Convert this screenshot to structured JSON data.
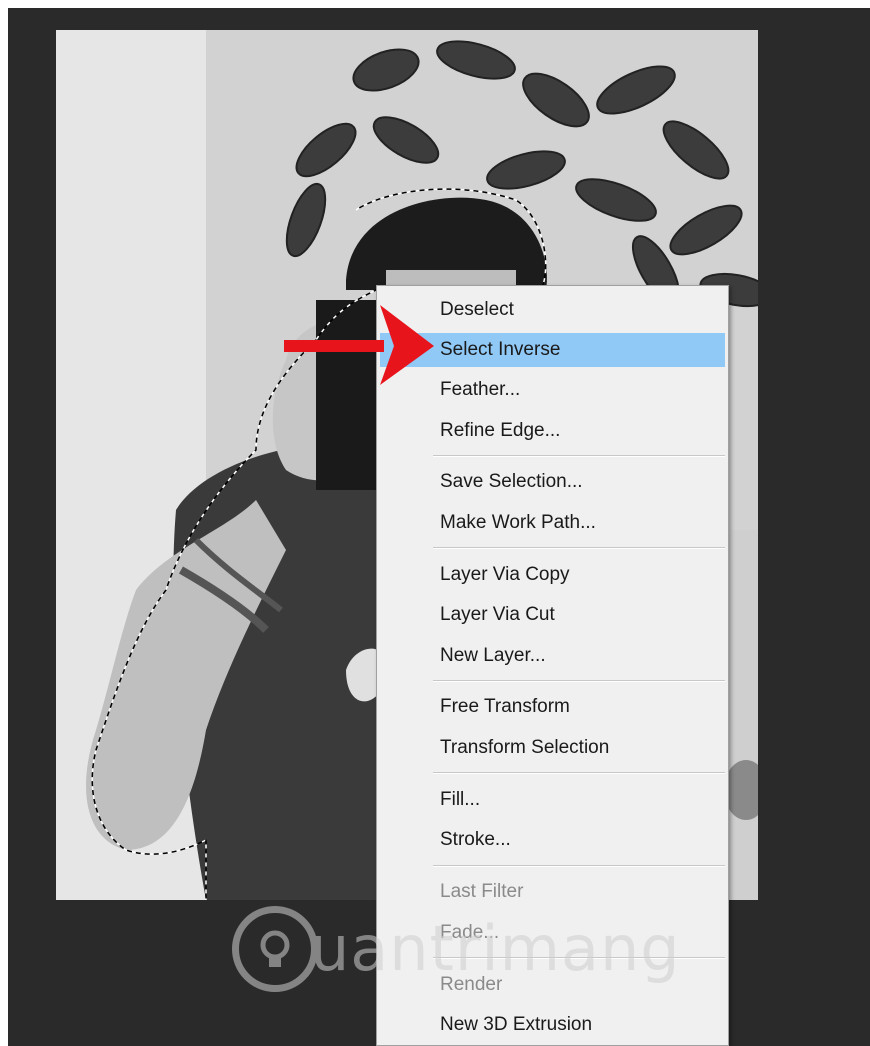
{
  "context_menu": {
    "items": [
      {
        "label": "Deselect",
        "state": "normal"
      },
      {
        "label": "Select Inverse",
        "state": "highlighted"
      },
      {
        "label": "Feather...",
        "state": "normal"
      },
      {
        "label": "Refine Edge...",
        "state": "normal"
      },
      {
        "label": "Save Selection...",
        "state": "normal"
      },
      {
        "label": "Make Work Path...",
        "state": "normal"
      },
      {
        "label": "Layer Via Copy",
        "state": "normal"
      },
      {
        "label": "Layer Via Cut",
        "state": "normal"
      },
      {
        "label": "New Layer...",
        "state": "normal"
      },
      {
        "label": "Free Transform",
        "state": "normal"
      },
      {
        "label": "Transform Selection",
        "state": "normal"
      },
      {
        "label": "Fill...",
        "state": "normal"
      },
      {
        "label": "Stroke...",
        "state": "normal"
      },
      {
        "label": "Last Filter",
        "state": "disabled"
      },
      {
        "label": "Fade...",
        "state": "disabled"
      },
      {
        "label": "Render",
        "state": "disabled"
      },
      {
        "label": "New 3D Extrusion",
        "state": "normal"
      }
    ]
  },
  "annotation": {
    "icon": "red-arrow-icon",
    "color": "#e8141c"
  },
  "watermark": {
    "text": "uantrimang",
    "icon": "lightbulb-icon"
  },
  "colors": {
    "workspace": "#2a2a2a",
    "menu_bg": "#f0f0f0",
    "highlight": "#90c8f6"
  }
}
